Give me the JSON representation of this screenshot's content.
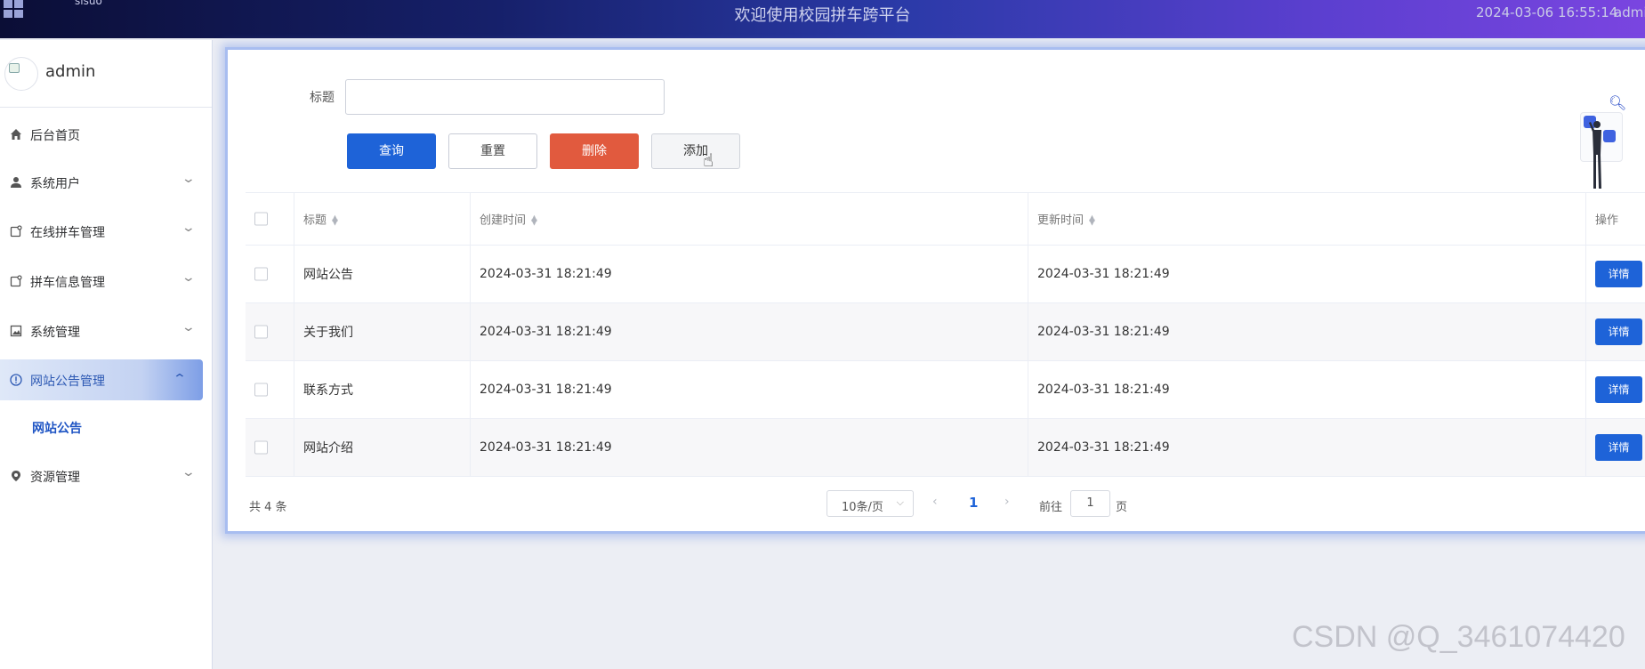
{
  "header": {
    "brand": "sisuo",
    "title": "欢迎使用校园拼车跨平台",
    "datetime": "2024-03-06 16:55:14",
    "user": "admi"
  },
  "sidebar": {
    "profile_name": "admin",
    "items": [
      {
        "label": "后台首页",
        "icon": "home-icon",
        "has_arrow": false
      },
      {
        "label": "系统用户",
        "icon": "user-icon",
        "has_arrow": true
      },
      {
        "label": "在线拼车管理",
        "icon": "doc-icon",
        "has_arrow": true
      },
      {
        "label": "拼车信息管理",
        "icon": "doc-icon",
        "has_arrow": true
      },
      {
        "label": "系统管理",
        "icon": "image-icon",
        "has_arrow": true
      },
      {
        "label": "网站公告管理",
        "icon": "info-icon",
        "has_arrow": true,
        "active": true,
        "expanded": true
      },
      {
        "label": "资源管理",
        "icon": "location-icon",
        "has_arrow": true
      }
    ],
    "sub_item": "网站公告"
  },
  "search": {
    "label": "标题",
    "value": "",
    "placeholder": ""
  },
  "toolbar": {
    "query_label": "查询",
    "reset_label": "重置",
    "delete_label": "删除",
    "add_label": "添加"
  },
  "table": {
    "columns": {
      "title": "标题",
      "created": "创建时间",
      "updated": "更新时间",
      "operation": "操作"
    },
    "rows": [
      {
        "title": "网站公告",
        "created": "2024-03-31 18:21:49",
        "updated": "2024-03-31 18:21:49",
        "action": "详情"
      },
      {
        "title": "关于我们",
        "created": "2024-03-31 18:21:49",
        "updated": "2024-03-31 18:21:49",
        "action": "详情"
      },
      {
        "title": "联系方式",
        "created": "2024-03-31 18:21:49",
        "updated": "2024-03-31 18:21:49",
        "action": "详情"
      },
      {
        "title": "网站介绍",
        "created": "2024-03-31 18:21:49",
        "updated": "2024-03-31 18:21:49",
        "action": "详情"
      }
    ]
  },
  "pagination": {
    "total_text": "共 4 条",
    "page_size": "10条/页",
    "current_page": "1",
    "goto_label": "前往",
    "goto_value": "1",
    "goto_unit": "页"
  },
  "watermark": "CSDN @Q_3461074420",
  "colors": {
    "primary": "#1e63d8",
    "danger": "#e15a3e",
    "active_menu_text": "#2c58b3"
  }
}
